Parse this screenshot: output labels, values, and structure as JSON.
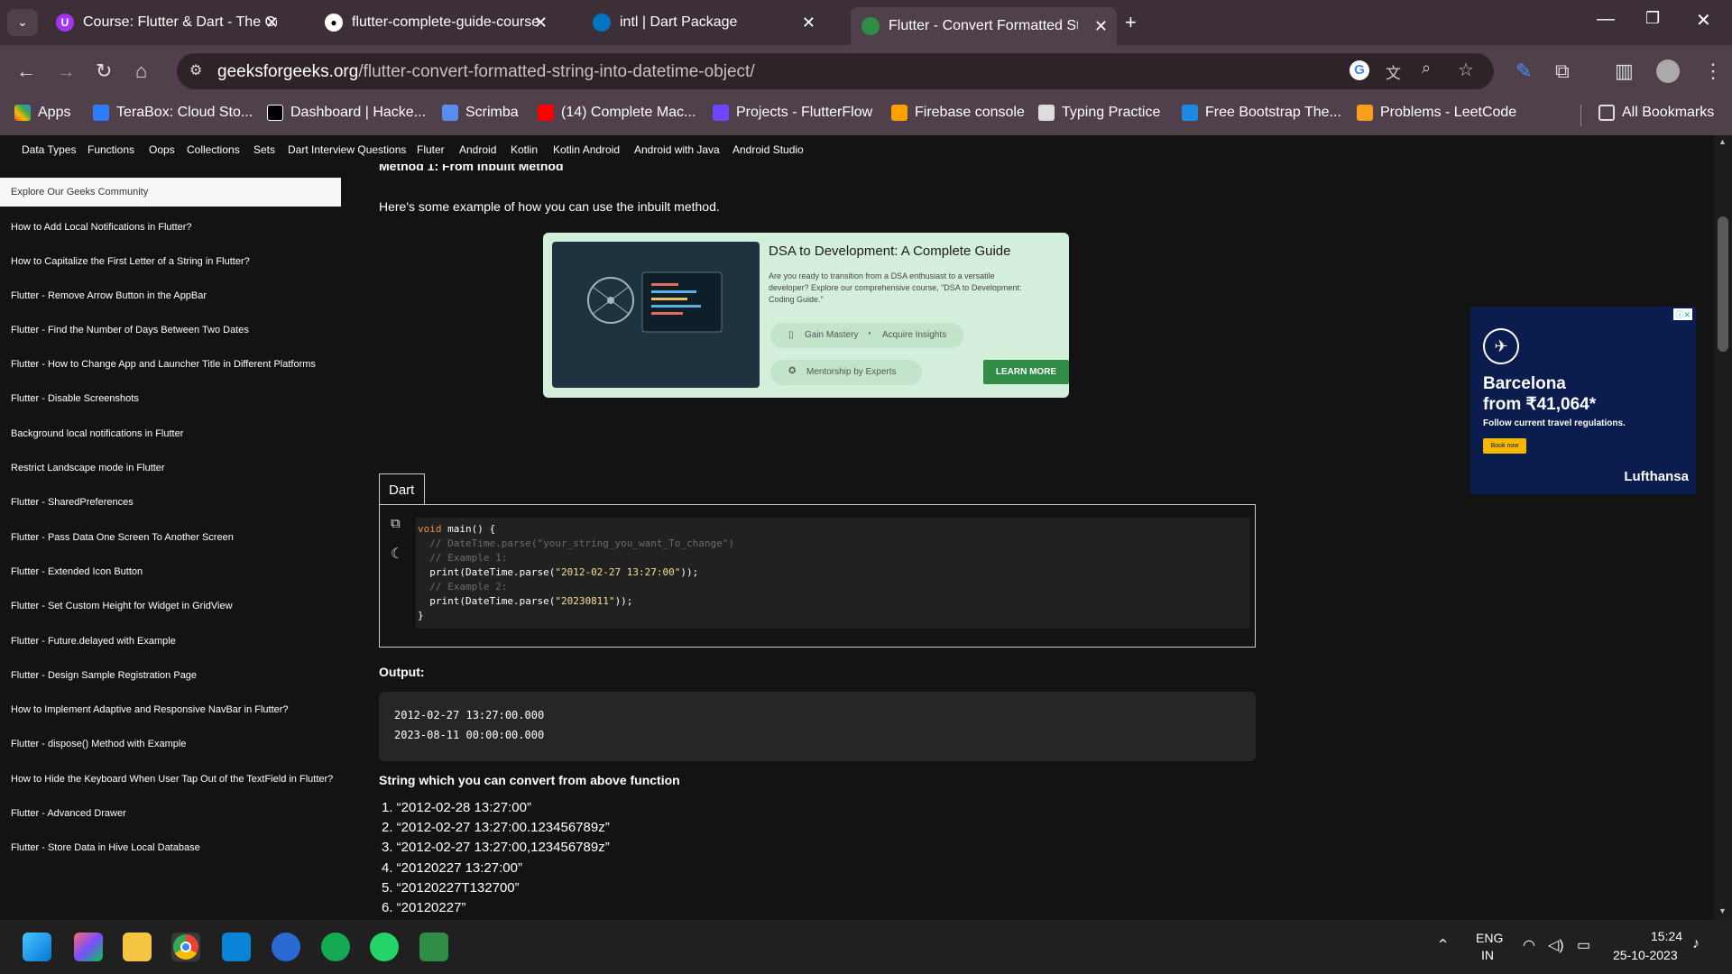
{
  "tabs": [
    {
      "title": "Course: Flutter & Dart - The Co",
      "icon": "udemy-icon",
      "color": "#a435f0"
    },
    {
      "title": "flutter-complete-guide-course",
      "icon": "github-icon",
      "color": "#ffffff"
    },
    {
      "title": "intl | Dart Package",
      "icon": "dart-icon",
      "color": "#0175c2"
    },
    {
      "title": "Flutter - Convert Formatted St",
      "icon": "gfg-icon",
      "color": "#2f8d46",
      "active": true
    }
  ],
  "address": {
    "domain": "geeksforgeeks.org",
    "path": "/flutter-convert-formatted-string-into-datetime-object/"
  },
  "bookmarks": [
    "Apps",
    "TeraBox: Cloud Sto...",
    "Dashboard | Hacke...",
    "Scrimba",
    "(14) Complete Mac...",
    "Projects - FlutterFlow",
    "Firebase console",
    "Typing Practice",
    "Free Bootstrap The...",
    "Problems - LeetCode",
    "All Bookmarks"
  ],
  "site_nav": [
    "Data Types",
    "Functions",
    "Oops",
    "Collections",
    "Sets",
    "Dart Interview Questions",
    "Fluter",
    "Android",
    "Kotlin",
    "Kotlin Android",
    "Android with Java",
    "Android Studio"
  ],
  "sidebar": {
    "explore": "Explore Our Geeks Community",
    "items": [
      "How to Add Local Notifications in Flutter?",
      "How to Capitalize the First Letter of a String in Flutter?",
      "Flutter - Remove Arrow Button in the AppBar",
      "Flutter - Find the Number of Days Between Two Dates",
      "Flutter - How to Change App and Launcher Title in Different Platforms",
      "Flutter - Disable Screenshots",
      "Background local notifications in Flutter",
      "Restrict Landscape mode in Flutter",
      "Flutter - SharedPreferences",
      "Flutter - Pass Data One Screen To Another Screen",
      "Flutter - Extended Icon Button",
      "Flutter - Set Custom Height for Widget in GridView",
      "Flutter - Future.delayed with Example",
      "Flutter - Design Sample Registration Page",
      "How to Implement Adaptive and Responsive NavBar in Flutter?",
      "Flutter - dispose() Method with Example",
      "How to Hide the Keyboard When User Tap Out of the TextField in Flutter?",
      "Flutter - Advanced Drawer",
      "Flutter - Store Data in Hive Local Database"
    ]
  },
  "article": {
    "heading": "Method 1: From inbuilt Method",
    "intro": "Here's some example of how you can use the inbuilt method.",
    "code_lang": "Dart",
    "code": {
      "l1_kw": "void",
      "l1_rest": " main() {",
      "l2": "  // DateTime.parse(\"your_string_you_want_To_change\")",
      "l3": "  // Example 1:",
      "l4_a": "  print(DateTime.parse(",
      "l4_s": "\"2012-02-27 13:27:00\"",
      "l4_b": "));",
      "l5": "  // Example 2:",
      "l6_a": "  print(DateTime.parse(",
      "l6_s": "\"20230811\"",
      "l6_b": "));",
      "l7": "}"
    },
    "output_label": "Output:",
    "output": [
      "2012-02-27 13:27:00.000",
      "2023-08-11 00:00:00.000"
    ],
    "list_heading": "String which you can convert from above function",
    "list": [
      "1. “2012-02-28 13:27:00”",
      "2. “2012-02-27 13:27:00.123456789z”",
      "3. “2012-02-27 13:27:00,123456789z”",
      "4. “20120227 13:27:00”",
      "5. “20120227T132700”",
      "6. “20120227”"
    ]
  },
  "ad": {
    "title": "DSA to Development: A Complete Guide",
    "desc": "Are you ready to transition from a DSA enthusiast to a versatile developer? Explore our comprehensive course, \"DSA to Development: Coding Guide.\"",
    "chip1": "Gain Mastery",
    "chip2": "Acquire Insights",
    "chip3": "Mentorship by Experts",
    "cta": "LEARN MORE"
  },
  "lufthansa": {
    "line1": "Barcelona",
    "line2": "from ₹41,064*",
    "line3": "Follow current travel regulations.",
    "cta": "Book now",
    "brand": "Lufthansa"
  },
  "taskbar": {
    "lang1": "ENG",
    "lang2": "IN",
    "time": "15:24",
    "date": "25-10-2023"
  }
}
